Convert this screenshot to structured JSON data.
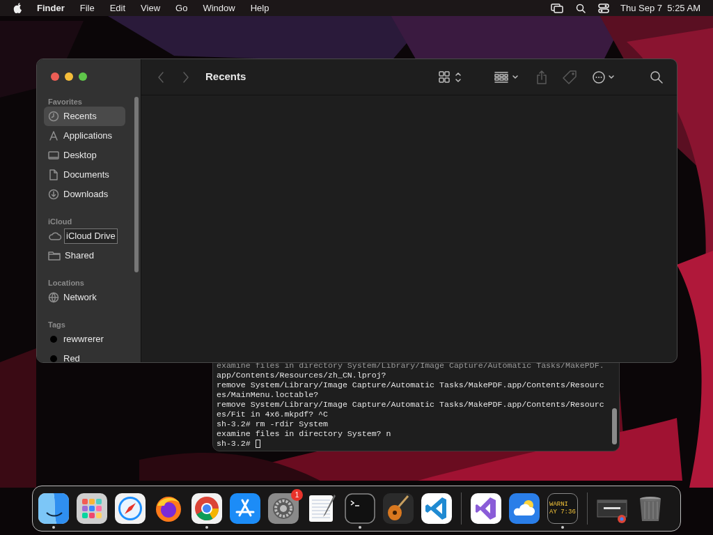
{
  "menu_bar": {
    "app": "Finder",
    "menus": [
      "File",
      "Edit",
      "View",
      "Go",
      "Window",
      "Help"
    ],
    "clock": "Thu Sep 7  5:25 AM"
  },
  "finder": {
    "title": "Recents",
    "toolbar": [
      {
        "kind": "back",
        "disabled": true
      },
      {
        "kind": "forward",
        "disabled": true
      },
      {
        "kind": "view",
        "disabled": false
      },
      {
        "kind": "group",
        "disabled": false
      },
      {
        "kind": "share",
        "disabled": true
      },
      {
        "kind": "tag",
        "disabled": true
      },
      {
        "kind": "more",
        "disabled": false
      },
      {
        "kind": "search",
        "disabled": false
      }
    ],
    "sidebar": [
      {
        "heading": "Favorites",
        "items": [
          {
            "label": "Recents",
            "kind": "clock",
            "selected": true,
            "editing": false
          },
          {
            "label": "Applications",
            "kind": "apps",
            "selected": false,
            "editing": false
          },
          {
            "label": "Desktop",
            "kind": "desktop",
            "selected": false,
            "editing": false
          },
          {
            "label": "Documents",
            "kind": "doc",
            "selected": false,
            "editing": false
          },
          {
            "label": "Downloads",
            "kind": "download",
            "selected": false,
            "editing": false
          }
        ]
      },
      {
        "heading": "iCloud",
        "items": [
          {
            "label": "iCloud Drive",
            "kind": "cloud",
            "selected": false,
            "editing": true
          },
          {
            "label": "Shared",
            "kind": "folder",
            "selected": false,
            "editing": false
          }
        ]
      },
      {
        "heading": "Locations",
        "items": [
          {
            "label": "Network",
            "kind": "globe",
            "selected": false,
            "editing": false
          }
        ]
      },
      {
        "heading": "Tags",
        "items": [
          {
            "label": "rewwrerer",
            "kind": "tag",
            "color": "#000000",
            "selected": false,
            "editing": false
          },
          {
            "label": "Red",
            "kind": "tag",
            "color": "#000000",
            "selected": false,
            "editing": false
          }
        ]
      }
    ]
  },
  "terminal": {
    "lines": [
      "examine files in directory System/Library/Image Capture/Automatic Tasks/MakePDF.",
      "app/Contents/Resources/zh_CN.lproj?",
      "remove System/Library/Image Capture/Automatic Tasks/MakePDF.app/Contents/Resourc",
      "es/MainMenu.loctable?",
      "remove System/Library/Image Capture/Automatic Tasks/MakePDF.app/Contents/Resourc",
      "es/Fit in 4x6.mkpdf? ^C",
      "sh-3.2# rm -rdir System",
      "examine files in directory System? n",
      "sh-3.2#"
    ]
  },
  "dock": [
    {
      "kind": "finder",
      "running": true
    },
    {
      "kind": "launchpad",
      "running": false
    },
    {
      "kind": "safari",
      "running": false
    },
    {
      "kind": "firefox",
      "running": false
    },
    {
      "kind": "chrome",
      "running": true
    },
    {
      "kind": "appstore",
      "running": false
    },
    {
      "kind": "settings",
      "running": false,
      "badge": "1"
    },
    {
      "kind": "textedit",
      "running": false
    },
    {
      "kind": "terminal",
      "running": true
    },
    {
      "kind": "guitar",
      "running": false
    },
    {
      "kind": "vscode",
      "running": false
    },
    {
      "kind": "divider"
    },
    {
      "kind": "visualstudio",
      "running": false
    },
    {
      "kind": "weather",
      "running": false
    },
    {
      "kind": "console",
      "running": true,
      "lines": [
        "WARNI",
        "AY 7:36"
      ]
    },
    {
      "kind": "divider"
    },
    {
      "kind": "window",
      "running": false
    },
    {
      "kind": "trash",
      "running": false
    }
  ]
}
